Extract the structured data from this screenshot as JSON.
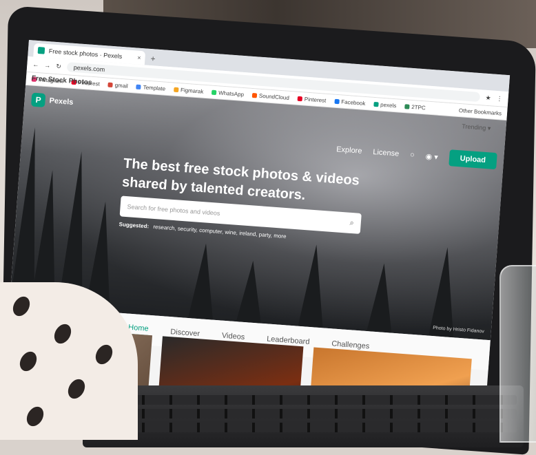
{
  "browser": {
    "tab_title": "Free stock photos · Pexels",
    "tab_close": "×",
    "new_tab": "+",
    "address": "pexels.com",
    "bookmarks": [
      "Instagram",
      "Pinterest",
      "gmail",
      "Template",
      "Figmarak",
      "WhatsApp",
      "SoundCloud",
      "Pinterest",
      "Facebook",
      "pexels",
      "2TPC"
    ],
    "other_bookmarks": "Other Bookmarks"
  },
  "site": {
    "logo_letter": "P",
    "logo_text": "Pexels",
    "nav": {
      "explore": "Explore",
      "license": "License",
      "upload": "Upload"
    },
    "headline_line1": "The best free stock photos & videos",
    "headline_line2": "shared by talented creators.",
    "search_placeholder": "Search for free photos and videos",
    "suggested_label": "Suggested:",
    "suggested_terms": "research, security, computer, wine, ireland, party, more",
    "photo_credit": "Photo by Hristo Fidanov",
    "tabs": [
      "Home",
      "Discover",
      "Videos",
      "Leaderboard",
      "Challenges"
    ],
    "section_title": "Free Stock Photos",
    "sort_label": "Trending ▾"
  },
  "colors": {
    "brand": "#05a081"
  }
}
